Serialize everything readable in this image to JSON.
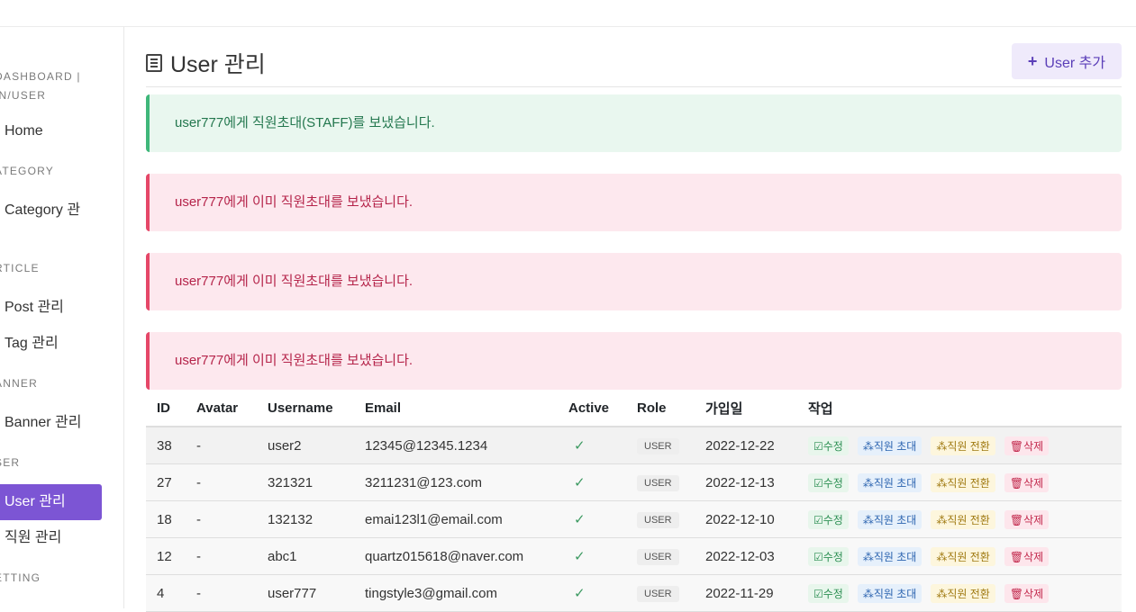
{
  "sidebar": {
    "sections": [
      {
        "heading_line1": "DASHBOARD |",
        "heading_line2": "IN/USER",
        "items": [
          "Home"
        ]
      },
      {
        "heading": "ATEGORY",
        "items": [
          "Category 관"
        ]
      },
      {
        "heading": "RTICLE",
        "items": [
          "Post 관리",
          "Tag 관리"
        ]
      },
      {
        "heading": "ANNER",
        "items": [
          "Banner 관리"
        ]
      },
      {
        "heading": "SER",
        "items": [
          "User 관리",
          "직원 관리"
        ]
      },
      {
        "heading": "ETTING",
        "items": []
      }
    ],
    "active_item": "User 관리"
  },
  "header": {
    "title": "User 관리",
    "add_button_label": "User 추가"
  },
  "alerts": [
    {
      "type": "success",
      "message": "user777에게 직원초대(STAFF)를 보냈습니다."
    },
    {
      "type": "danger",
      "message": "user777에게 이미 직원초대를 보냈습니다."
    },
    {
      "type": "danger",
      "message": "user777에게 이미 직원초대를 보냈습니다."
    },
    {
      "type": "danger",
      "message": "user777에게 이미 직원초대를 보냈습니다."
    }
  ],
  "table": {
    "columns": [
      "ID",
      "Avatar",
      "Username",
      "Email",
      "Active",
      "Role",
      "가입일",
      "작업"
    ],
    "rows": [
      {
        "id": "38",
        "avatar": "-",
        "username": "user2",
        "email": "12345@12345.1234",
        "active": "✓",
        "role": "USER",
        "joined": "2022-12-22"
      },
      {
        "id": "27",
        "avatar": "-",
        "username": "321321",
        "email": "3211231@123.com",
        "active": "✓",
        "role": "USER",
        "joined": "2022-12-13"
      },
      {
        "id": "18",
        "avatar": "-",
        "username": "132132",
        "email": "emai123l1@email.com",
        "active": "✓",
        "role": "USER",
        "joined": "2022-12-10"
      },
      {
        "id": "12",
        "avatar": "-",
        "username": "abc1",
        "email": "quartz015618@naver.com",
        "active": "✓",
        "role": "USER",
        "joined": "2022-12-03"
      },
      {
        "id": "4",
        "avatar": "-",
        "username": "user777",
        "email": "tingstyle3@gmail.com",
        "active": "✓",
        "role": "USER",
        "joined": "2022-11-29"
      }
    ],
    "actions": {
      "edit": "☑수정",
      "invite": "⁂직원 초대",
      "switch": "⁂직원 전환",
      "delete": "🗑삭제"
    }
  },
  "colors": {
    "accent": "#7c55d4",
    "success": "#3fb77a",
    "danger": "#e54768"
  }
}
